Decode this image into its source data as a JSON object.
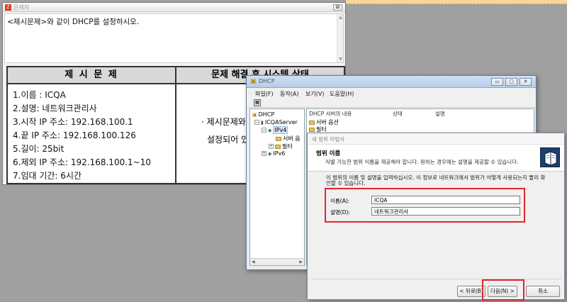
{
  "problem_window": {
    "title": "문제지",
    "close_glyph": "⊠",
    "instruction": "<제시문제>와 같이 DHCP를 설정하시오.",
    "left_header": "제 시 문 제",
    "right_header": "문제 해결 후 시스템 상태",
    "specs": [
      "1.이름 : ICQA",
      "2.설명: 네트워크관리사",
      "3.시작 IP 주소: 192.168.100.1",
      "4.끝 IP 주소: 192.168.100.126",
      "5.길이: 25bit",
      "6.제외 IP 주소: 192.168.100.1~10",
      "7.임대 기간: 6시간"
    ],
    "status_lines": [
      "· 제시문제와",
      "설정되어 있"
    ]
  },
  "dhcp_window": {
    "title": "DHCP",
    "menu": [
      "파일(F)",
      "동작(A)",
      "보기(V)",
      "도움말(H)"
    ],
    "tree": {
      "root": "DHCP",
      "server": "ICQAServer",
      "ipv4": "IPv4",
      "ipv4_children": [
        "서버 옵",
        "필터"
      ],
      "ipv6": "IPv6"
    },
    "list_headers": [
      "DHCP 서버의 내용",
      "상태",
      "설명"
    ],
    "list_items": [
      "서버 옵션",
      "필터"
    ]
  },
  "wizard": {
    "title": "새 범위 마법사",
    "heading": "범위 이름",
    "subtext": "식별 가능한 범위 이름을 제공해야 합니다. 원하는 경우에는 설명을 제공할 수 있습니다.",
    "instruction": "이 범위의 이름 및 설명을 입력하십시오. 이 정보로 네트워크에서 범위가 어떻게 사용되는지 빨리 확인할 수 있습니다.",
    "name_label": "이름(A):",
    "name_value": "ICQA",
    "desc_label": "설명(D):",
    "desc_value": "네트워크관리사",
    "back_button": "< 뒤로(B)",
    "next_button": "다음(N) >",
    "cancel_button": "취소"
  },
  "colors": {
    "highlight": "#e0262b",
    "header_fill": "#d9d9d9"
  }
}
